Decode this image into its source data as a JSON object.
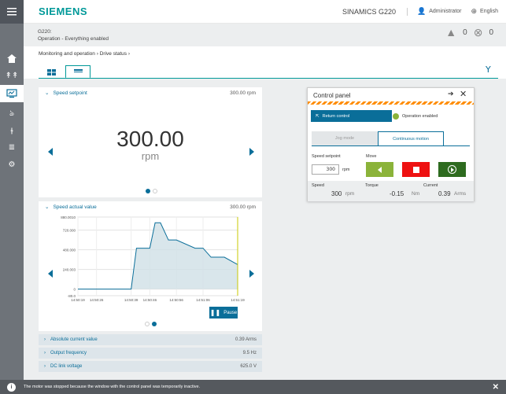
{
  "header": {
    "brand": "SIEMENS",
    "product": "SINAMICS G220",
    "user": "Administrator",
    "language": "English"
  },
  "status": {
    "device": "G220:",
    "message": "Operation - Everything enabled",
    "warnings": "0",
    "errors": "0"
  },
  "breadcrumb": {
    "item1": "Monitoring and operation",
    "item2": "Drive status"
  },
  "speed_setpoint_card": {
    "title": "Speed setpoint",
    "value": "300.00 rpm",
    "big_value": "300.00",
    "unit": "rpm"
  },
  "speed_actual_card": {
    "title": "Speed actual value",
    "value": "300.00 rpm",
    "pause_label": "Pause"
  },
  "rows": [
    {
      "label": "Absolute current value",
      "value": "0.39 Arms"
    },
    {
      "label": "Output frequency",
      "value": "9.5 Hz"
    },
    {
      "label": "DC link voltage",
      "value": "625.0 V"
    }
  ],
  "control_panel": {
    "title": "Control panel",
    "return_label": "Return control",
    "enabled_label": "Operation enabled",
    "jog_mode": "Jog mode",
    "continuous": "Continuous motion",
    "setpoint_label": "Speed setpoint",
    "setpoint_value": "300",
    "setpoint_unit": "rpm",
    "move_label": "Move",
    "speed_label": "Speed",
    "speed_value": "300",
    "speed_unit": "rpm",
    "torque_label": "Torque",
    "torque_value": "-0.15",
    "torque_unit": "Nm",
    "current_label": "Current",
    "current_value": "0.39",
    "current_unit": "Arms"
  },
  "notice": "The motor was stopped because the window with the control panel was temporarily inactive.",
  "chart_data": {
    "type": "area",
    "x": [
      "14:50:19",
      "14:50:22",
      "14:50:25",
      "14:50:26",
      "14:50:29",
      "14:50:38",
      "14:50:39",
      "14:50:41",
      "14:50:42",
      "14:50:46",
      "14:50:48",
      "14:50:50",
      "14:50:53",
      "14:50:56",
      "14:51:03",
      "14:51:06",
      "14:51:09",
      "14:51:14",
      "14:51:19"
    ],
    "y": [
      0,
      0,
      0,
      0,
      0,
      0,
      0,
      500,
      500,
      500,
      810,
      810,
      600,
      600,
      500,
      500,
      390,
      390,
      300
    ],
    "x_ticks": [
      "14:50:19",
      "14:50:26",
      "14:50:39",
      "14:50:46",
      "14:50:56",
      "14:51:06",
      "14:51:19"
    ],
    "y_ticks": [
      "880.0010",
      "720.000",
      "480.000",
      "240.003",
      "0",
      "-80.0"
    ],
    "ylim": [
      -80,
      880
    ]
  }
}
